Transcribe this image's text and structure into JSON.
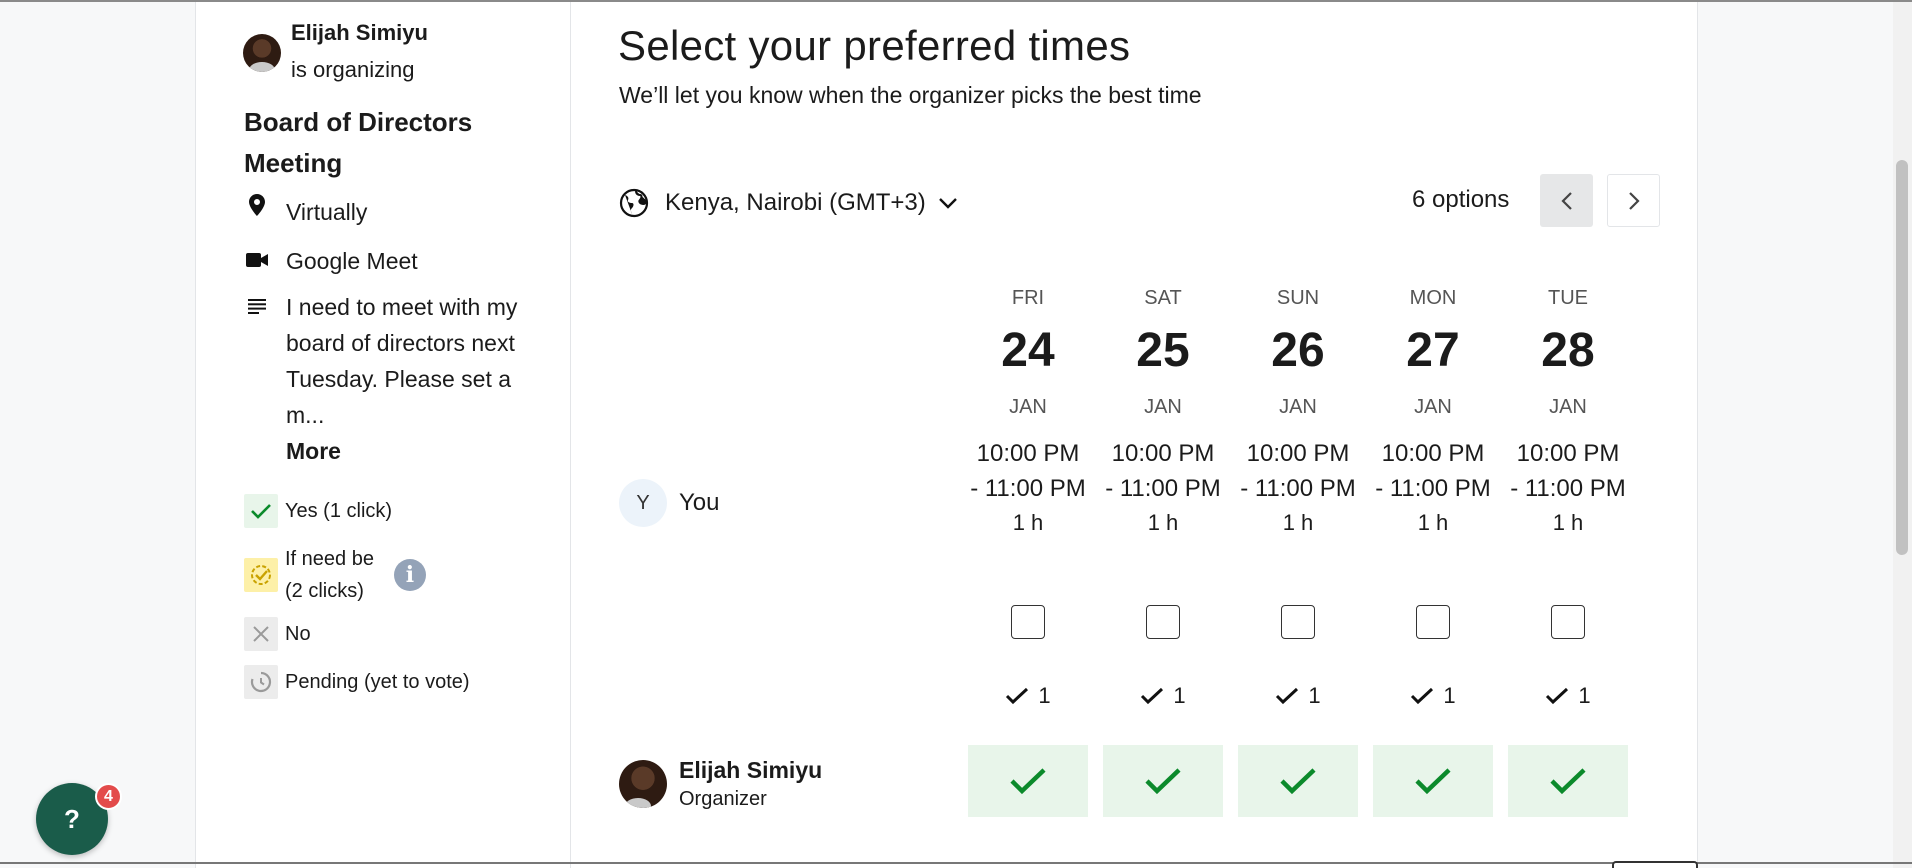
{
  "sidebar": {
    "organizer_name": "Elijah Simiyu",
    "organizer_sub": "is organizing",
    "meeting_title": "Board of Directors Meeting",
    "location": "Virtually",
    "platform": "Google Meet",
    "description": "I need to meet with my board of directors next Tuesday. Please set a m...",
    "more_label": "More",
    "legend": {
      "yes": "Yes (1 click)",
      "ifneed_line1": "If need be",
      "ifneed_line2": "(2 clicks)",
      "no": "No",
      "pending": "Pending (yet to vote)"
    },
    "icons": [
      "location-pin-icon",
      "video-camera-icon",
      "description-lines-icon",
      "check-icon",
      "if-need-be-icon",
      "x-icon",
      "pending-clock-icon",
      "info-icon"
    ]
  },
  "main": {
    "title": "Select your preferred times",
    "subtitle": "We’ll let you know when the organizer picks the best time",
    "timezone": "Kenya, Nairobi (GMT+3)",
    "options_count": "6 options"
  },
  "columns": [
    {
      "dow": "FRI",
      "day": "24",
      "mon": "JAN",
      "time": "10:00 PM\n- 11:00 PM",
      "dur": "1 h",
      "tally": "1"
    },
    {
      "dow": "SAT",
      "day": "25",
      "mon": "JAN",
      "time": "10:00 PM\n- 11:00 PM",
      "dur": "1 h",
      "tally": "1"
    },
    {
      "dow": "SUN",
      "day": "26",
      "mon": "JAN",
      "time": "10:00 PM\n- 11:00 PM",
      "dur": "1 h",
      "tally": "1"
    },
    {
      "dow": "MON",
      "day": "27",
      "mon": "JAN",
      "time": "10:00 PM\n- 11:00 PM",
      "dur": "1 h",
      "tally": "1"
    },
    {
      "dow": "TUE",
      "day": "28",
      "mon": "JAN",
      "time": "10:00 PM\n- 11:00 PM",
      "dur": "1 h",
      "tally": "1"
    }
  ],
  "you": {
    "initial": "Y",
    "name": "You"
  },
  "participant": {
    "name": "Elijah Simiyu",
    "role": "Organizer",
    "votes": [
      "yes",
      "yes",
      "yes",
      "yes",
      "yes"
    ]
  },
  "help": {
    "label": "?",
    "badge": "4"
  },
  "colors": {
    "accent_green": "#0b8a2b",
    "vote_bg": "#e8f5ea",
    "help_bg": "#1a5c4a",
    "badge_red": "#e34b4b"
  }
}
